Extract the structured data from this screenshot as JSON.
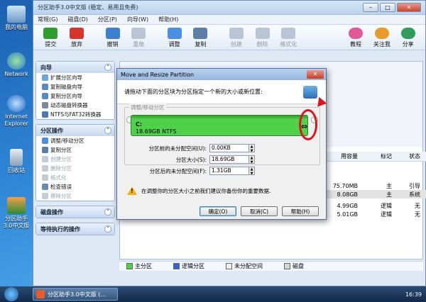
{
  "desktop": {
    "icons": [
      {
        "label": "我的电脑"
      },
      {
        "label": "Network"
      },
      {
        "label": "Internet Explorer"
      },
      {
        "label": "回收站"
      },
      {
        "label": "分区助手3.0中文版"
      }
    ]
  },
  "app": {
    "title": "分区助手3.0中文版 (稳定、易用且免费)",
    "menu": [
      "常规(G)",
      "磁盘(D)",
      "分区(P)",
      "向导(W)",
      "帮助(H)"
    ],
    "toolbar": {
      "commit": "提交",
      "discard": "放弃",
      "undo": "撤销",
      "redo": "重做",
      "adjust": "调整",
      "copy": "复制",
      "create": "创建",
      "delete": "删除",
      "format": "格式化",
      "tutorial": "教程",
      "follow": "关注我",
      "share": "分享"
    }
  },
  "sidebar": {
    "wizard": {
      "title": "向导",
      "items": [
        "扩展分区向导",
        "复制磁盘向导",
        "复制分区向导",
        "动态磁盘转换器",
        "NTFS与FAT32转换器"
      ]
    },
    "partition_ops": {
      "title": "分区操作",
      "items": [
        "调整/移动分区",
        "复制分区",
        "创建分区",
        "删除分区",
        "格式化",
        "检查错误",
        "擦除分区"
      ]
    },
    "disk_ops": {
      "title": "磁盘操作"
    },
    "pending_ops": {
      "title": "等待执行的操作"
    }
  },
  "table": {
    "headers": [
      "用容量",
      "标记",
      "状态"
    ],
    "rows": [
      {
        "size": "75.70MB",
        "flag": "主",
        "status": "引导"
      },
      {
        "size": "8.08GB",
        "flag": "主",
        "status": "系统"
      },
      {
        "size": "4.99GB",
        "flag": "逻辑",
        "status": "无"
      },
      {
        "size": "5.01GB",
        "flag": "逻辑",
        "status": "无"
      }
    ]
  },
  "legend": [
    "主分区",
    "逻辑分区",
    "未分配空间",
    "磁盘"
  ],
  "dialog": {
    "title": "Move and Resize Partition",
    "instruction": "请拖动下面的分区块为分区指定一个新的大小或新位置:",
    "group_label": "调整/移动分区",
    "partition_drive": "C:",
    "partition_info": "18.69GB NTFS",
    "fields": {
      "before_label": "分区前的未分配空间(U):",
      "before_value": "0.00KB",
      "size_label": "分区大小(S):",
      "size_value": "18.69GB",
      "after_label": "分区后的未分配空间(F):",
      "after_value": "1.31GB"
    },
    "warning": "在调整你的分区大小之前我们建议你备份你的重要数据.",
    "ok": "确定(O)",
    "cancel": "取消(C)",
    "help": "帮助(H)"
  },
  "taskbar": {
    "task_label": "分区助手3.0中文版 (...",
    "clock": "16:39"
  },
  "colors": {
    "primary_partition": "#4fd14a",
    "highlight": "#e0121a"
  }
}
